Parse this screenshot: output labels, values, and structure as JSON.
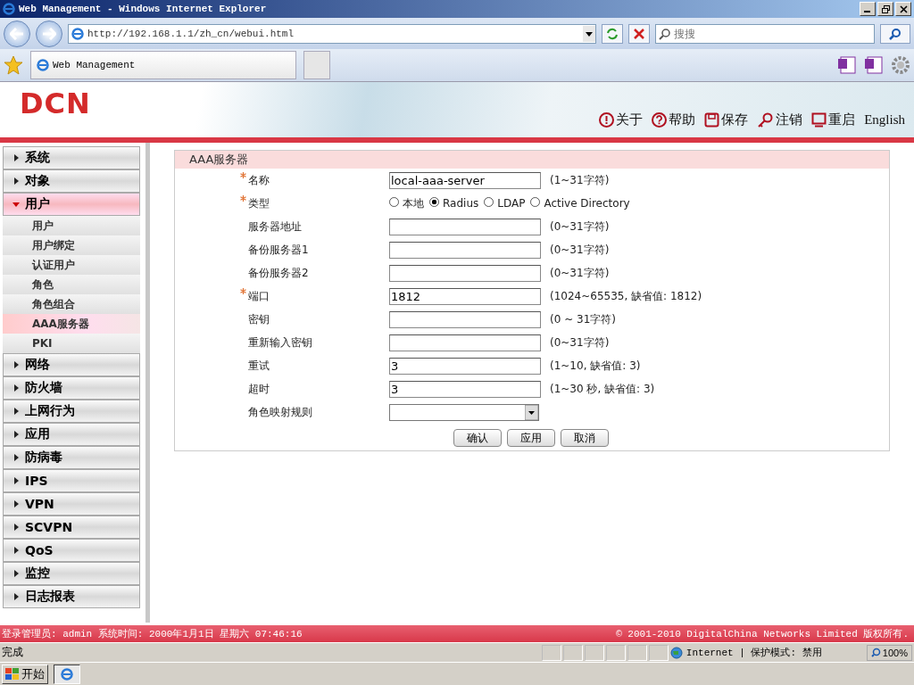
{
  "window": {
    "title": "Web Management - Windows Internet Explorer"
  },
  "browser": {
    "url": "http://192.168.1.1/zh_cn/webui.html",
    "search_placeholder": "搜搜",
    "tab": "Web Management"
  },
  "header": {
    "logo": "DCN",
    "links": [
      {
        "label": "关于",
        "kind": "about"
      },
      {
        "label": "帮助",
        "kind": "help"
      },
      {
        "label": "保存",
        "kind": "save"
      },
      {
        "label": "注销",
        "kind": "logout"
      },
      {
        "label": "重启",
        "kind": "reboot"
      },
      {
        "label": "English",
        "kind": "text"
      }
    ]
  },
  "sidebar": {
    "items": [
      {
        "label": "系统",
        "expanded": false
      },
      {
        "label": "对象",
        "expanded": false
      },
      {
        "label": "用户",
        "expanded": true,
        "children": [
          {
            "label": "用户",
            "selected": false
          },
          {
            "label": "用户绑定",
            "selected": false
          },
          {
            "label": "认证用户",
            "selected": false
          },
          {
            "label": "角色",
            "selected": false
          },
          {
            "label": "角色组合",
            "selected": false
          },
          {
            "label": "AAA服务器",
            "selected": true
          },
          {
            "label": "PKI",
            "selected": false
          }
        ]
      },
      {
        "label": "网络",
        "expanded": false
      },
      {
        "label": "防火墙",
        "expanded": false
      },
      {
        "label": "上网行为",
        "expanded": false
      },
      {
        "label": "应用",
        "expanded": false
      },
      {
        "label": "防病毒",
        "expanded": false
      },
      {
        "label": "IPS",
        "expanded": false
      },
      {
        "label": "VPN",
        "expanded": false
      },
      {
        "label": "SCVPN",
        "expanded": false
      },
      {
        "label": "QoS",
        "expanded": false
      },
      {
        "label": "监控",
        "expanded": false
      },
      {
        "label": "日志报表",
        "expanded": false
      }
    ]
  },
  "form": {
    "title": "AAA服务器",
    "fields": [
      {
        "kind": "text",
        "label": "名称",
        "required": true,
        "value": "local-aaa-server",
        "hint": "(1~31字符)"
      },
      {
        "kind": "radio",
        "label": "类型",
        "required": true,
        "options": [
          {
            "label": "本地",
            "selected": false
          },
          {
            "label": "Radius",
            "selected": true
          },
          {
            "label": "LDAP",
            "selected": false
          },
          {
            "label": "Active Directory",
            "selected": false
          }
        ]
      },
      {
        "kind": "text",
        "label": "服务器地址",
        "required": false,
        "hint": "(0~31字符)"
      },
      {
        "kind": "text",
        "label": "备份服务器1",
        "required": false,
        "hint": "(0~31字符)"
      },
      {
        "kind": "text",
        "label": "备份服务器2",
        "required": false,
        "hint": "(0~31字符)"
      },
      {
        "kind": "text",
        "label": "端口",
        "required": true,
        "value": "1812",
        "hint": "(1024~65535, 缺省值: 1812)"
      },
      {
        "kind": "text",
        "label": "密钥",
        "required": false,
        "hint": "(0 ~ 31字符)"
      },
      {
        "kind": "text",
        "label": "重新输入密钥",
        "required": false,
        "hint": "(0~31字符)"
      },
      {
        "kind": "text",
        "label": "重试",
        "required": false,
        "value": "3",
        "hint": "(1~10, 缺省值: 3)"
      },
      {
        "kind": "text",
        "label": "超时",
        "required": false,
        "value": "3",
        "hint": "(1~30 秒, 缺省值: 3)"
      },
      {
        "kind": "select",
        "label": "角色映射规则",
        "required": false
      }
    ],
    "buttons": [
      "确认",
      "应用",
      "取消"
    ]
  },
  "footer": {
    "login": "登录管理员: admin 系统时间: 2000年1月1日 星期六 07:46:16",
    "copyright": "© 2001-2010 DigitalChina Networks Limited 版权所有."
  },
  "status_bar": {
    "status": "完成",
    "zone": "Internet | 保护模式: 禁用",
    "zoom": "100%"
  },
  "taskbar": {
    "start": "开始"
  }
}
